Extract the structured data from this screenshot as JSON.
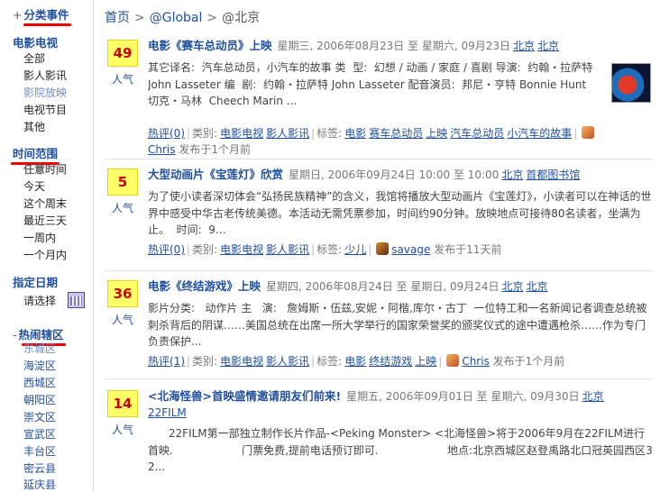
{
  "sidebar": {
    "categories": {
      "head": "分类事件",
      "prefix": "+",
      "group": "电影电视",
      "items": [
        "全部",
        "影人影讯",
        "影院放映",
        "电视节目",
        "其他"
      ]
    },
    "time_range": {
      "head": "时间范围",
      "items": [
        "任意时间",
        "今天",
        "这个周末",
        "最近三天",
        "一周内",
        "一个月内"
      ]
    },
    "date": {
      "head": "指定日期",
      "choose_label": "请选择"
    },
    "districts": {
      "head": "热闹辖区",
      "prefix": "-",
      "items": [
        "东城区",
        "海淀区",
        "西城区",
        "朝阳区",
        "崇文区",
        "宣武区",
        "丰台区",
        "密云县",
        "延庆县"
      ]
    }
  },
  "breadcrumb": {
    "home": "首页",
    "sep": ">",
    "global": "@Global",
    "current": "@北京"
  },
  "popularity_label": "人气",
  "entries": [
    {
      "count": "49",
      "title": "电影《赛车总动员》上映",
      "time": "星期三, 2006年08月23日  至  星期六, 09月23日",
      "loc1": "北京",
      "loc2": "北京",
      "desc": "其它译名:  汽车总动员，小汽车的故事 类  型:  幻想 / 动画 / 家庭 / 喜剧 导演:  约翰・拉萨特 John Lasseter 编  剧:  约翰・拉萨特 John Lasseter 配音演员:  邦尼・亨特 Bonnie Hunt 切克・马林  Cheech Marin ...",
      "comments": "热评(0)",
      "category_label": "类别:",
      "cat1": "电影电视",
      "cat2": "影人影讯",
      "tag_label": "标签:",
      "tags": [
        "电影",
        "赛车总动员",
        "上映",
        "汽车总动员",
        "小汽车的故事"
      ],
      "user": "Chris",
      "posted": "发布于1个月前"
    },
    {
      "count": "5",
      "title": "大型动画片《宝莲灯》欣赏",
      "time": "星期日, 2006年09月24日  10:00 至  10:00",
      "loc1": "北京",
      "loc2": "首都图书馆",
      "desc": "为了使小读者深切体会“弘扬民族精神”的含义，我馆将播放大型动画片《宝莲灯》，小读者可以在神话的世界中感受中华古老传统美德。本活动无需凭票参加，时间约90分钟。放映地点可接待80名读者，坐满为止。  时间:  9...",
      "comments": "热评(0)",
      "category_label": "类别:",
      "cat1": "电影电视",
      "cat2": "影人影讯",
      "tag_label": "标签:",
      "tags": [
        "少儿"
      ],
      "user": "savage",
      "posted": "发布于11天前"
    },
    {
      "count": "36",
      "title": "电影《终结游戏》上映",
      "time": "星期四, 2006年08月24日  至  星期日, 09月24日",
      "loc1": "北京",
      "loc2": "北京",
      "desc": "影片分类:   动作片 主   演:   詹姆斯・伍兹,安妮・阿楷,库尔・古丁  一位特工和一名新闻记者调查总统被刺杀背后的阴谋……美国总统在出席一所大学举行的国家荣誉奖的颁奖仪式的途中遭遇枪杀……作为专门负责保护...",
      "comments": "热评(1)",
      "category_label": "类别:",
      "cat1": "电影电视",
      "cat2": "影人影讯",
      "tag_label": "标签:",
      "tags": [
        "电影",
        "终结游戏",
        "上映"
      ],
      "user": "Chris",
      "posted": "发布于1个月前"
    },
    {
      "count": "14",
      "title": "<北海怪兽>首映盛情邀请朋友们前来!",
      "time": "星期五, 2006年09月01日  至  星期六, 09月30日",
      "loc1": "北京",
      "loc2": "22FILM",
      "desc": "      22FILM第一部独立制作长片作品-<Peking Monster> <北海怪兽>将于2006年9月在22FILM进行首映.                    门票免费,提前电话预订即可.                    地点:北京西城区赵登禹路北口冠英园西区32...",
      "comments": "",
      "category_label": "",
      "cat1": "",
      "cat2": "",
      "tag_label": "",
      "tags": [],
      "user": "",
      "posted": ""
    }
  ]
}
